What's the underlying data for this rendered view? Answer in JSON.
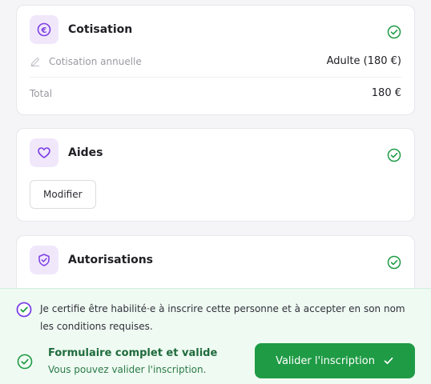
{
  "cotisation": {
    "title": "Cotisation",
    "icon": "euro-icon",
    "row_label": "Cotisation annuelle",
    "row_value": "Adulte (180 €)",
    "total_label": "Total",
    "total_value": "180 €"
  },
  "aides": {
    "title": "Aides",
    "icon": "heart-icon",
    "edit_button": "Modifier"
  },
  "autorisations": {
    "title": "Autorisations",
    "icon": "shield-check-icon"
  },
  "footer": {
    "certification_text": "Je certifie être habilité·e à inscrire cette personne et à accepter en son nom les conditions requises.",
    "status_title": "Formulaire complet et valide",
    "status_subtitle": "Vous pouvez valider l'inscription.",
    "submit_button": "Valider l'inscription"
  },
  "colors": {
    "accent_purple": "#7b3fe4",
    "success_green": "#1f9b45",
    "footer_bg": "#effaf2"
  }
}
